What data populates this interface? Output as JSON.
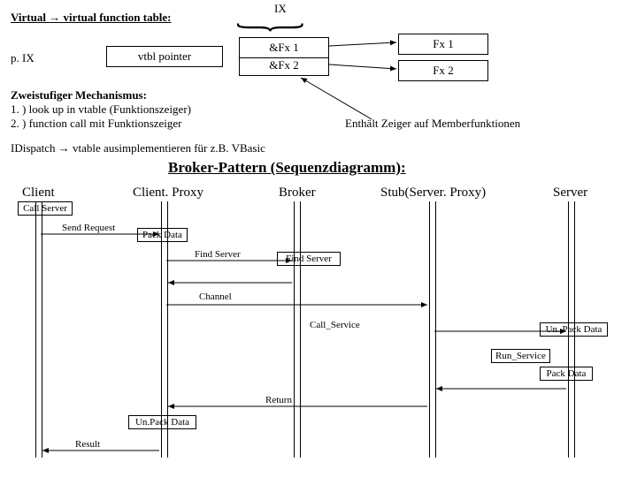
{
  "vtable": {
    "title": "Virtual → virtual function table:",
    "ix_label": "IX",
    "pix": "p. IX",
    "vtbl_pointer": "vtbl pointer",
    "entries": [
      "&Fx 1",
      "&Fx 2"
    ],
    "fx": [
      "Fx 1",
      "Fx 2"
    ],
    "mech_title": "Zweistufiger Mechanismus:",
    "mech_1": "1. ) look up in vtable (Funktionszeiger)",
    "mech_2": "2. ) function call mit Funktionszeiger",
    "note": "Enthält Zeiger auf Memberfunktionen",
    "idispatch": "IDispatch → vtable ausimplementieren für z.B. VBasic"
  },
  "broker": {
    "title": "Broker-Pattern (Sequenzdiagramm):",
    "actors": {
      "client": "Client",
      "client_proxy": "Client. Proxy",
      "broker_actor": "Broker",
      "stub": "Stub(Server. Proxy)",
      "server": "Server"
    },
    "msgs": {
      "call_server": "Call Server",
      "send_request": "Send Request",
      "pack_data_1": "Pack Data",
      "find_server_1": "Find Server",
      "find_server_2": "Find Server",
      "channel": "Channel",
      "call_service": "Call_Service",
      "unpack_data_1": "Un. Pack Data",
      "run_service": "Run_Service",
      "pack_data_2": "Pack Data",
      "return": "Return",
      "unpack_data_2": "Un.Pack Data",
      "result": "Result"
    }
  }
}
